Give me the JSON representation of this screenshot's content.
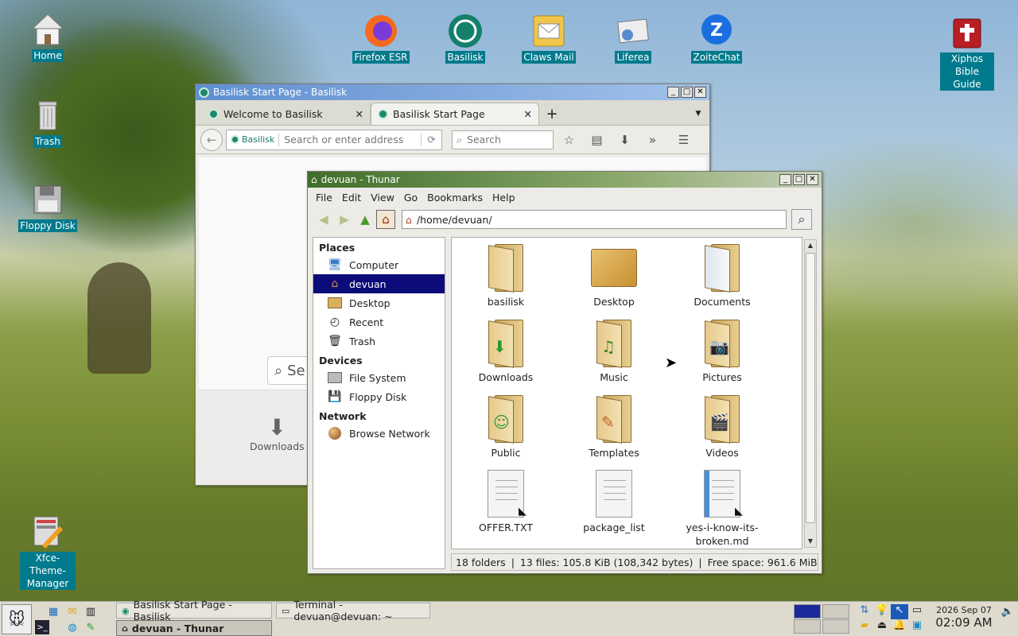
{
  "desktop": {
    "icons": [
      {
        "label": "Home"
      },
      {
        "label": "Trash"
      },
      {
        "label": "Floppy Disk"
      },
      {
        "label": "Firefox ESR"
      },
      {
        "label": "Basilisk"
      },
      {
        "label": "Claws Mail"
      },
      {
        "label": "Liferea"
      },
      {
        "label": "ZoiteChat"
      },
      {
        "label": "Xiphos Bible Guide"
      },
      {
        "label": "Xfce-Theme-Manager"
      }
    ]
  },
  "basilisk": {
    "title": "Basilisk Start Page - Basilisk",
    "tabs": [
      {
        "label": "Welcome to Basilisk"
      },
      {
        "label": "Basilisk Start Page"
      }
    ],
    "identity_label": "Basilisk",
    "url_placeholder": "Search or enter address",
    "search_placeholder": "Search",
    "content_search_text": "Se",
    "downloads_label": "Downloads"
  },
  "thunar": {
    "title": "devuan - Thunar",
    "menu": [
      "File",
      "Edit",
      "View",
      "Go",
      "Bookmarks",
      "Help"
    ],
    "path": "/home/devuan/",
    "places_header": "Places",
    "places": [
      {
        "label": "Computer",
        "icon": "computer-icon"
      },
      {
        "label": "devuan",
        "icon": "home-folder-icon",
        "selected": true
      },
      {
        "label": "Desktop",
        "icon": "desktop-folder-icon"
      },
      {
        "label": "Recent",
        "icon": "clock-icon"
      },
      {
        "label": "Trash",
        "icon": "trash-icon"
      }
    ],
    "devices_header": "Devices",
    "devices": [
      {
        "label": "File System",
        "icon": "drive-icon"
      },
      {
        "label": "Floppy Disk",
        "icon": "floppy-icon"
      }
    ],
    "network_header": "Network",
    "network": [
      {
        "label": "Browse Network",
        "icon": "network-icon"
      }
    ],
    "files": [
      {
        "name": "basilisk",
        "kind": "folder",
        "icon": "folder-icon"
      },
      {
        "name": "Desktop",
        "kind": "folder",
        "icon": "desktop-folder-icon"
      },
      {
        "name": "Documents",
        "kind": "folder",
        "icon": "documents-folder-icon"
      },
      {
        "name": "Downloads",
        "kind": "folder",
        "icon": "downloads-folder-icon"
      },
      {
        "name": "Music",
        "kind": "folder",
        "icon": "music-folder-icon"
      },
      {
        "name": "Pictures",
        "kind": "folder",
        "icon": "pictures-folder-icon"
      },
      {
        "name": "Public",
        "kind": "folder",
        "icon": "public-folder-icon"
      },
      {
        "name": "Templates",
        "kind": "folder",
        "icon": "templates-folder-icon"
      },
      {
        "name": "Videos",
        "kind": "folder",
        "icon": "videos-folder-icon"
      },
      {
        "name": "OFFER.TXT",
        "kind": "file",
        "icon": "text-file-link-icon"
      },
      {
        "name": "package_list",
        "kind": "file",
        "icon": "text-file-icon"
      },
      {
        "name": "yes-i-know-its-broken.md",
        "kind": "file",
        "icon": "markdown-file-link-icon"
      }
    ],
    "status": {
      "folders": "18 folders",
      "files": "13 files: 105.8 KiB (108,342 bytes)",
      "free": "Free space: 961.6 MiB"
    }
  },
  "taskbar": {
    "tasks": [
      {
        "label": "Basilisk Start Page - Basilisk"
      },
      {
        "label": "Terminal - devuan@devuan: ~"
      },
      {
        "label": "devuan - Thunar",
        "active": true
      }
    ],
    "clock": {
      "date": "2026 Sep 07",
      "time": "02:09 AM"
    }
  }
}
